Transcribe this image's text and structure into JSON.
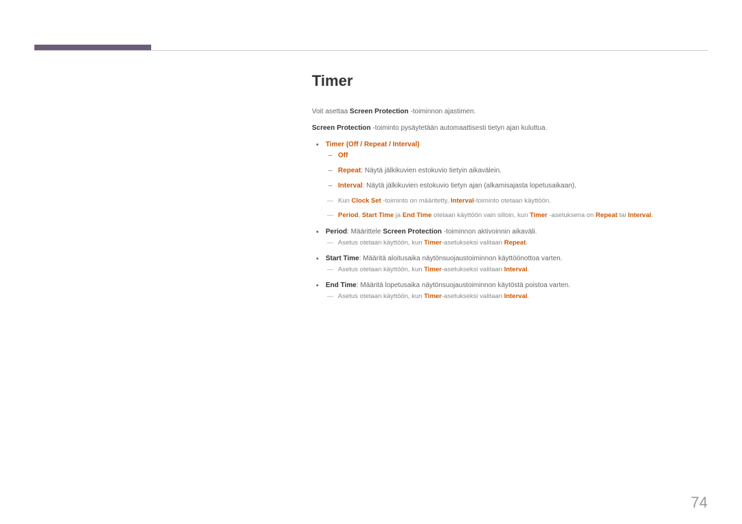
{
  "title": "Timer",
  "intro1": {
    "pre": "Voit asettaa ",
    "hl1": "Screen Protection",
    "post": " -toiminnon ajastimen."
  },
  "intro2": {
    "hl1": "Screen Protection",
    "post": " -toiminto pysäytetään automaattisesti tietyn ajan kuluttua."
  },
  "bullet1": {
    "timer": "Timer",
    "options": " (Off / Repeat / Interval)",
    "off": "Off",
    "repeat": "Repeat",
    "repeatText": ": Näytä jälkikuvien estokuvio tietyin aikavälein.",
    "interval": "Interval",
    "intervalText": ": Näytä jälkikuvien estokuvio tietyn ajan (alkamisajasta lopetusaikaan).",
    "note1a": "Kun ",
    "note1b": "Clock Set",
    "note1c": " -toiminto on määritetty, ",
    "note1d": "Interval",
    "note1e": "-toiminto otetaan käyttöön.",
    "note2a": "Period",
    "note2b": ", ",
    "note2c": "Start Time",
    "note2d": " ja ",
    "note2e": "End Time",
    "note2f": " otetaan käyttöön vain silloin, kun ",
    "note2g": "Timer",
    "note2h": " -asetuksena on ",
    "note2i": "Repeat",
    "note2j": " tai ",
    "note2k": "Interval",
    "note2l": "."
  },
  "bullet2": {
    "period": "Period",
    "text1": ": Määrittele ",
    "sp": "Screen Protection",
    "text2": " -toiminnon aktivoinnin aikaväli.",
    "noteA": "Asetus otetaan käyttöön, kun ",
    "noteB": "Timer",
    "noteC": "-asetukseksi valitaan ",
    "noteD": "Repeat",
    "noteE": "."
  },
  "bullet3": {
    "start": "Start Time",
    "text": ": Määritä aloitusaika näytönsuojaustoiminnon käyttöönottoa varten.",
    "noteA": "Asetus otetaan käyttöön, kun ",
    "noteB": "Timer",
    "noteC": "-asetukseksi valitaan ",
    "noteD": "Interval",
    "noteE": "."
  },
  "bullet4": {
    "end": "End Time",
    "text": ": Määritä lopetusaika näytönsuojaustoiminnon käytöstä poistoa varten.",
    "noteA": "Asetus otetaan käyttöön, kun ",
    "noteB": "Timer",
    "noteC": "-asetukseksi valitaan ",
    "noteD": "Interval",
    "noteE": "."
  },
  "pageNumber": "74"
}
